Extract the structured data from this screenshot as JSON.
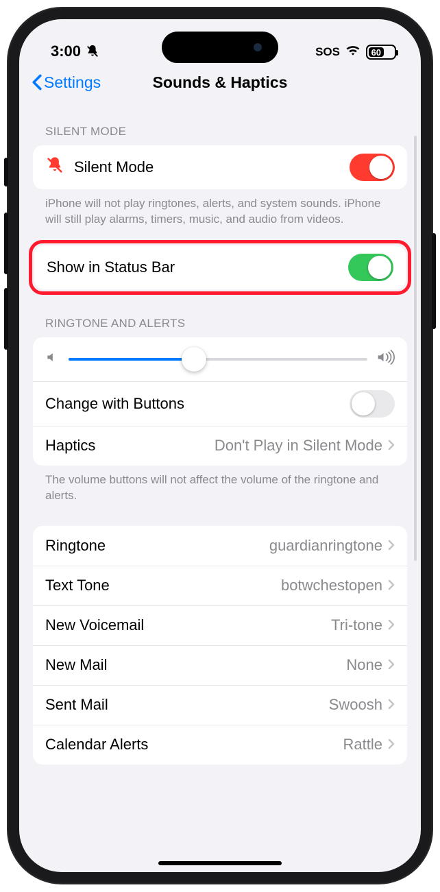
{
  "status": {
    "time": "3:00",
    "sos": "SOS",
    "battery_pct": "60"
  },
  "nav": {
    "back_label": "Settings",
    "title": "Sounds & Haptics"
  },
  "section_silent": {
    "header": "SILENT MODE",
    "row_label": "Silent Mode",
    "footer": "iPhone will not play ringtones, alerts, and system sounds. iPhone will still play alarms, timers, music, and audio from videos.",
    "statusbar_label": "Show in Status Bar"
  },
  "section_ringtone": {
    "header": "RINGTONE AND ALERTS",
    "change_buttons_label": "Change with Buttons",
    "haptics_label": "Haptics",
    "haptics_value": "Don't Play in Silent Mode",
    "footer": "The volume buttons will not affect the volume of the ringtone and alerts.",
    "slider_pct": 42
  },
  "sounds": [
    {
      "label": "Ringtone",
      "value": "guardianringtone"
    },
    {
      "label": "Text Tone",
      "value": "botwchestopen"
    },
    {
      "label": "New Voicemail",
      "value": "Tri-tone"
    },
    {
      "label": "New Mail",
      "value": "None"
    },
    {
      "label": "Sent Mail",
      "value": "Swoosh"
    },
    {
      "label": "Calendar Alerts",
      "value": "Rattle"
    }
  ]
}
